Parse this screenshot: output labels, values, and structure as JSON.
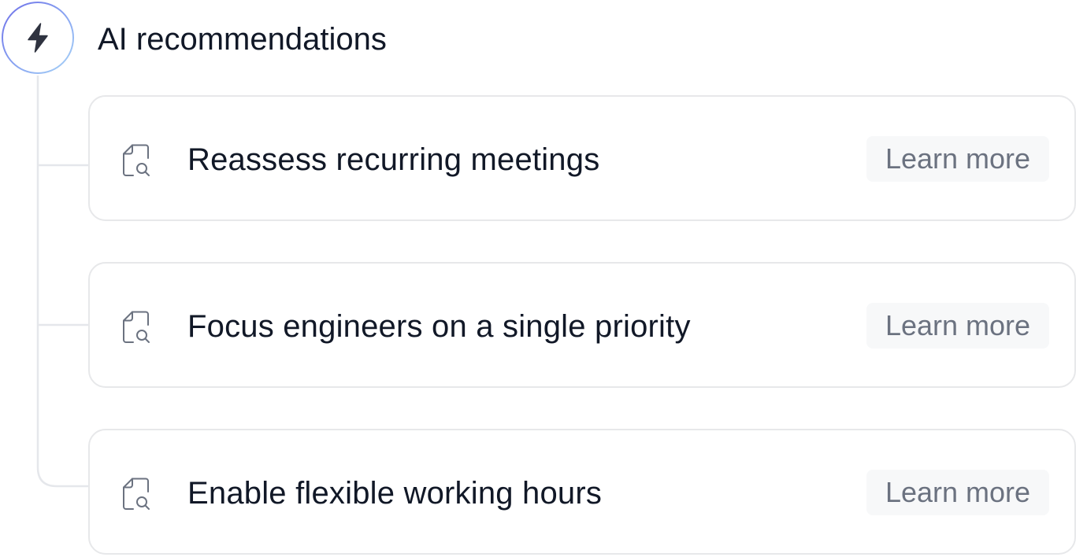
{
  "header": {
    "title": "AI recommendations",
    "icon": "lightning-bolt-icon"
  },
  "recommendations": [
    {
      "label": "Reassess recurring meetings",
      "action": "Learn more",
      "icon": "document-search-icon"
    },
    {
      "label": "Focus engineers on a single priority",
      "action": "Learn more",
      "icon": "document-search-icon"
    },
    {
      "label": "Enable flexible working hours",
      "action": "Learn more",
      "icon": "document-search-icon"
    }
  ],
  "colors": {
    "text": "#111827",
    "muted": "#6b7280",
    "border": "#e7e8ea",
    "button_bg": "#f7f8f9",
    "gradient_start": "#6d6ee8",
    "gradient_end": "#a9d6f7"
  }
}
